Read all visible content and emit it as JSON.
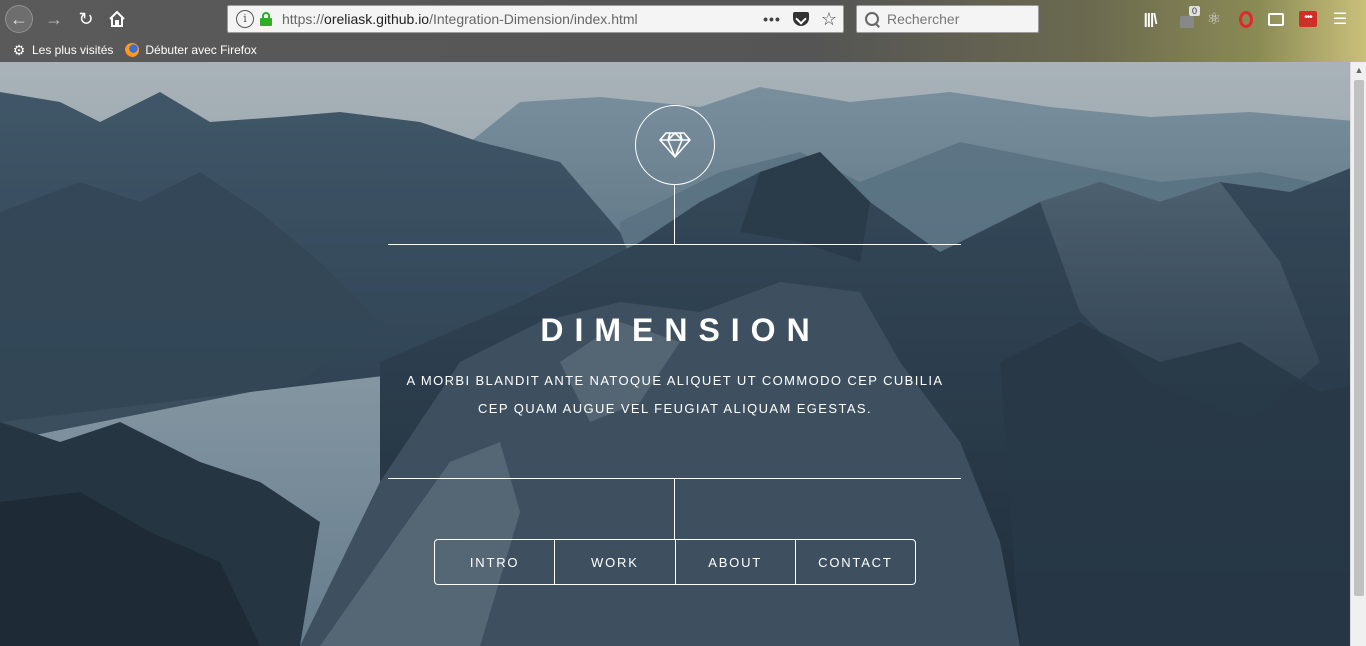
{
  "browser": {
    "url_scheme": "https://",
    "url_host": "oreliask.github.io",
    "url_path": "/Integration-Dimension/index.html",
    "search_placeholder": "Rechercher",
    "counter_badge": "0",
    "bookmarks": [
      {
        "label": "Les plus visités",
        "icon": "gear-icon"
      },
      {
        "label": "Débuter avec Firefox",
        "icon": "firefox-icon"
      }
    ]
  },
  "page": {
    "logo_icon": "diamond-icon",
    "title": "DIMENSION",
    "subtitle_line1": "A MORBI BLANDIT ANTE NATOQUE ALIQUET UT COMMODO CEP CUBILIA",
    "subtitle_line2": "CEP QUAM AUGUE VEL FEUGIAT ALIQUAM EGESTAS.",
    "nav": [
      {
        "label": "INTRO"
      },
      {
        "label": "WORK"
      },
      {
        "label": "ABOUT"
      },
      {
        "label": "CONTACT"
      }
    ]
  },
  "colors": {
    "ssl_green": "#2bb024",
    "accent_white": "#ffffff"
  }
}
